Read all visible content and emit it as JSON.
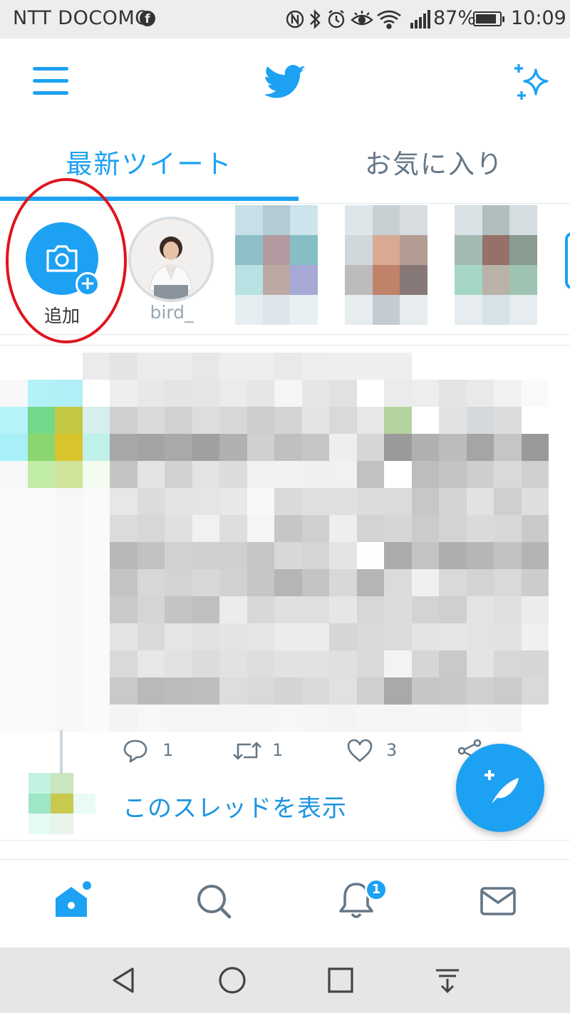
{
  "status_bar": {
    "carrier": "NTT DOCOMO",
    "battery_percent": "87%",
    "battery_level": 0.87,
    "time": "10:09",
    "icons": [
      "facebook-icon",
      "nfc-icon",
      "bluetooth-icon",
      "alarm-icon",
      "eye-comfort-icon",
      "wifi-icon",
      "signal-icon",
      "battery-icon"
    ]
  },
  "app_bar": {
    "icons": [
      "menu-icon",
      "twitter-bird-icon",
      "sparkle-icon"
    ]
  },
  "tabs": [
    {
      "label": "最新ツイート",
      "active": true
    },
    {
      "label": "お気に入り",
      "active": false
    }
  ],
  "fleets": {
    "add_label": "追加",
    "items": [
      {
        "label": "bird_"
      }
    ]
  },
  "tweet": {
    "reply_count": "1",
    "retweet_count": "1",
    "like_count": "3",
    "show_thread_label": "このスレッドを表示"
  },
  "bottom_nav": {
    "items": [
      "home-icon",
      "search-icon",
      "notifications-icon",
      "messages-icon"
    ],
    "notification_badge": "1"
  },
  "colors": {
    "accent": "#1da1f2",
    "annotation": "#e0141e",
    "muted_text": "#657786"
  }
}
